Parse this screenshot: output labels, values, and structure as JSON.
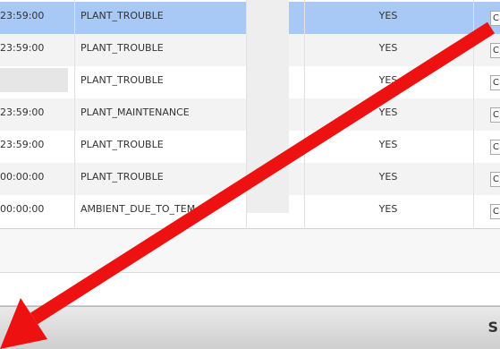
{
  "grid": {
    "rows": [
      {
        "time": "23:59:00",
        "reason": "PLANT_TROUBLE",
        "flag": "YES",
        "button": "C",
        "selected": true
      },
      {
        "time": "23:59:00",
        "reason": "PLANT_TROUBLE",
        "flag": "YES",
        "button": "C"
      },
      {
        "time": "",
        "reason": "PLANT_TROUBLE",
        "flag": "YES",
        "button": "C"
      },
      {
        "time": "23:59:00",
        "reason": "PLANT_MAINTENANCE",
        "flag": "YES",
        "button": "C"
      },
      {
        "time": "23:59:00",
        "reason": "PLANT_TROUBLE",
        "flag": "YES",
        "button": "C"
      },
      {
        "time": "00:00:00",
        "reason": "PLANT_TROUBLE",
        "flag": "YES",
        "button": "C"
      },
      {
        "time": "00:00:00",
        "reason": "AMBIENT_DUE_TO_TEM",
        "flag": "YES",
        "button": "C"
      }
    ]
  },
  "footer": {
    "edge_char": "S"
  },
  "annotation": {
    "arrow_color": "#ee1111",
    "arrow_icon": "red-arrow-icon"
  }
}
